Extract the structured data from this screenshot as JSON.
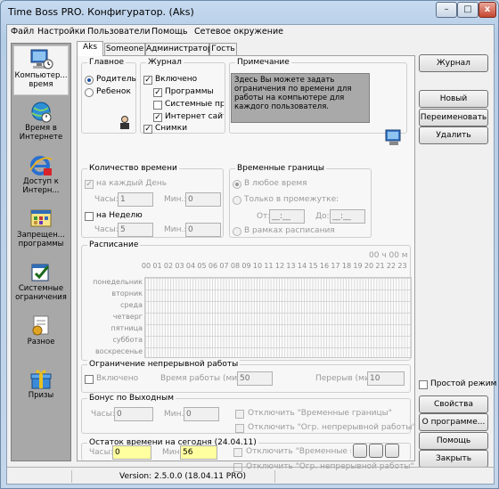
{
  "window": {
    "title": "Time Boss PRO. Конфигуратор. (Aks)",
    "close_label": "x",
    "min_label": "–",
    "max_label": "□"
  },
  "menu": [
    "Файл",
    "Настройки",
    "Пользователи",
    "Помощь",
    "Сетевое окружение"
  ],
  "sidebar": [
    {
      "label": "Компьютер... время",
      "icon": "computer-icon"
    },
    {
      "label": "Время в Интернете",
      "icon": "internet-icon"
    },
    {
      "label": "Доступ к Интерн...",
      "icon": "ie-icon"
    },
    {
      "label": "Запрещен... программы",
      "icon": "programs-icon"
    },
    {
      "label": "Системные ограничения",
      "icon": "system-icon"
    },
    {
      "label": "Разное",
      "icon": "misc-icon"
    },
    {
      "label": "Призы",
      "icon": "gift-icon"
    }
  ],
  "tabs": [
    "Aks",
    "Someone",
    "Администратор",
    "Гость"
  ],
  "main_group": {
    "title": "Главное",
    "parent": "Родитель",
    "child": "Ребенок"
  },
  "journal_group": {
    "title": "Журнал",
    "items": [
      "Включено",
      "Программы",
      "Системные про",
      "Интернет сайты",
      "Снимки"
    ]
  },
  "note": {
    "title": "Примечание",
    "text": "Здесь Вы можете задать ограничения по времени для работы на компьютере для каждого пользователя."
  },
  "time_amount": {
    "title": "Количество времени",
    "daily": "на каждый День",
    "weekly": "на Неделю",
    "hours": "Часы:",
    "minutes": "Мин.:",
    "day_hours": "1",
    "day_min": "0",
    "week_hours": "5",
    "week_min": "0"
  },
  "time_bounds": {
    "title": "Временные границы",
    "any_time": "В любое время",
    "only_range": "Только в промежутке:",
    "from": "От:",
    "to": "До:",
    "from_val": "__:__",
    "to_val": "__:__",
    "schedule": "В рамках расписания"
  },
  "schedule": {
    "title": "Расписание",
    "time_label": "00 ч 00 м",
    "hours": [
      "00",
      "01",
      "02",
      "03",
      "04",
      "05",
      "06",
      "07",
      "08",
      "09",
      "10",
      "11",
      "12",
      "13",
      "14",
      "15",
      "16",
      "17",
      "18",
      "19",
      "20",
      "21",
      "22",
      "23"
    ],
    "days": [
      "понедельник",
      "вторник",
      "среда",
      "четверг",
      "пятница",
      "суббота",
      "воскресенье"
    ]
  },
  "continuous": {
    "title": "Ограничение непрерывной работы",
    "enabled": "Включено",
    "work_time": "Время работы (мин.):",
    "work_val": "50",
    "break": "Перерыв (мин.):",
    "break_val": "10"
  },
  "weekend_bonus": {
    "title": "Бонус по Выходным",
    "hours": "Часы:",
    "hours_val": "0",
    "min": "Мин.:",
    "min_val": "0",
    "disable_bounds": "Отключить \"Временные границы\"",
    "disable_continuous": "Отключить \"Огр. непрерывной работы\""
  },
  "remaining": {
    "title": "Остаток времени на сегодня  (24.04.11)",
    "hours": "Часы:",
    "hours_val": "0",
    "min": "Мин.:",
    "min_val": "56",
    "disable_bounds": "Отключить \"Временные границ",
    "disable_continuous": "Отключить \"Огр. непрерывной работы\""
  },
  "right_buttons": {
    "journal": "Журнал",
    "new": "Новый",
    "rename": "Переименовать",
    "delete": "Удалить",
    "simple_mode": "Простой режим",
    "properties": "Свойства",
    "about": "О программе...",
    "help": "Помощь",
    "close": "Закрыть"
  },
  "status": {
    "version": "Version: 2.5.0.0 (18.04.11 PRO)"
  },
  "colors": {
    "sidebar_bg": "#a8a8a8",
    "note_bg": "#a9a9a9",
    "highlight_field": "#ffffa0"
  }
}
